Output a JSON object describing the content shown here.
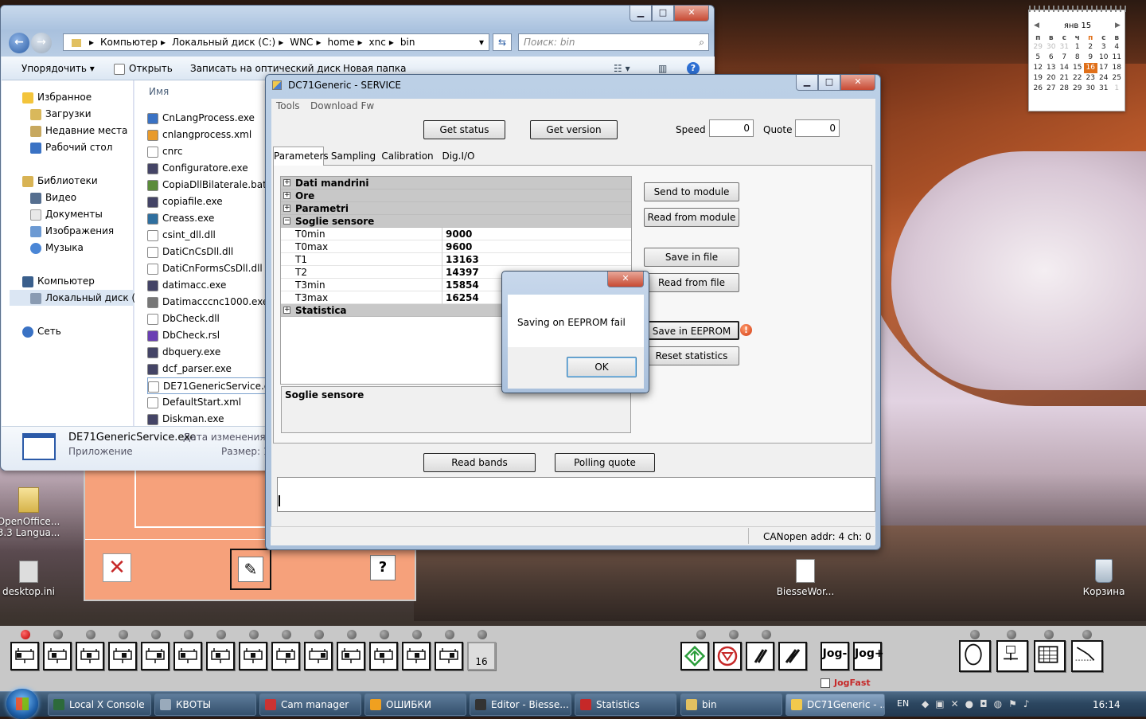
{
  "explorer": {
    "breadcrumb": [
      "Компьютер",
      "Локальный диск (C:)",
      "WNC",
      "home",
      "xnc",
      "bin"
    ],
    "search_placeholder": "Поиск: bin",
    "toolbar": {
      "organize": "Упорядочить",
      "open": "Открыть",
      "burn": "Записать на оптический диск",
      "new_folder": "Новая папка"
    },
    "nav": {
      "favorites": "Избранное",
      "downloads": "Загрузки",
      "recent": "Недавние места",
      "desktop": "Рабочий стол",
      "libraries": "Библиотеки",
      "video": "Видео",
      "documents": "Документы",
      "images": "Изображения",
      "music": "Музыка",
      "computer": "Компьютер",
      "local_disk": "Локальный диск (С",
      "network": "Сеть"
    },
    "column_name": "Имя",
    "files": [
      "CnLangProcess.exe",
      "cnlangprocess.xml",
      "cnrc",
      "Configuratore.exe",
      "CopiaDllBilaterale.bat",
      "copiafile.exe",
      "Creass.exe",
      "csint_dll.dll",
      "DatiCnCsDll.dll",
      "DatiCnFormsCsDll.dll",
      "datimacc.exe",
      "Datimacccnc1000.exe",
      "DbCheck.dll",
      "DbCheck.rsl",
      "dbquery.exe",
      "dcf_parser.exe",
      "DE71GenericService.exe",
      "DefaultStart.xml",
      "Diskman.exe"
    ],
    "details": {
      "name": "DE71GenericService.exe",
      "type": "Приложение",
      "modified_label": "Дата изменения: 18",
      "size_label": "Размер: 1"
    }
  },
  "dc71": {
    "title": "DC71Generic - SERVICE",
    "menu": [
      "Tools",
      "Download Fw"
    ],
    "get_status": "Get status",
    "get_version": "Get version",
    "speed_label": "Speed",
    "speed_value": "0",
    "quote_label": "Quote",
    "quote_value": "0",
    "tabs": [
      "Parameters",
      "Sampling",
      "Calibration",
      "Dig.I/O"
    ],
    "groups": {
      "g1": "Dati mandrini",
      "g2": "Ore",
      "g3": "Parametri",
      "g4": "Soglie sensore",
      "g5": "Statistica"
    },
    "params": [
      {
        "k": "T0min",
        "v": "9000"
      },
      {
        "k": "T0max",
        "v": "9600"
      },
      {
        "k": "T1",
        "v": "13163"
      },
      {
        "k": "T2",
        "v": "14397"
      },
      {
        "k": "T3min",
        "v": "15854"
      },
      {
        "k": "T3max",
        "v": "16254"
      }
    ],
    "description": "Soglie sensore",
    "buttons": {
      "send": "Send to module",
      "read_module": "Read from module",
      "save_file": "Save in file",
      "read_file": "Read from file",
      "save_eeprom": "Save in EEPROM",
      "reset": "Reset statistics",
      "read_bands": "Read bands",
      "polling": "Polling quote"
    },
    "status": "CANopen addr: 4 ch: 0"
  },
  "dialog": {
    "message": "Saving on EEPROM fail",
    "ok": "OK"
  },
  "calendar": {
    "month": "янв 15",
    "days": [
      "п",
      "в",
      "с",
      "ч",
      "п",
      "с",
      "в"
    ],
    "weeks": [
      [
        "29",
        "30",
        "31",
        "1",
        "2",
        "3",
        "4"
      ],
      [
        "5",
        "6",
        "7",
        "8",
        "9",
        "10",
        "11"
      ],
      [
        "12",
        "13",
        "14",
        "15",
        "16",
        "17",
        "18"
      ],
      [
        "19",
        "20",
        "21",
        "22",
        "23",
        "24",
        "25"
      ],
      [
        "26",
        "27",
        "28",
        "29",
        "30",
        "31",
        "1"
      ]
    ],
    "today": "16"
  },
  "desktop": {
    "openoffice": "OpenOffice... 3.3 Langua...",
    "desktop_ini": "desktop.ini",
    "biesse": "BiesseWor...",
    "recycle": "Корзина"
  },
  "cnc": {
    "counter": "16",
    "jog_minus": "Jog-",
    "jog_plus": "Jog+",
    "jogfast": "JogFast"
  },
  "taskbar": {
    "items": [
      "Local X Console",
      "КВОТЫ",
      "Cam manager",
      "ОШИБКИ",
      "Editor - Biesse...",
      "Statistics",
      "bin",
      "DC71Generic - ..."
    ],
    "lang": "EN",
    "time": "16:14"
  },
  "colors": {
    "accent": "#c62828",
    "dialog_close": "#c74a33",
    "panel": "#f6a17b"
  }
}
